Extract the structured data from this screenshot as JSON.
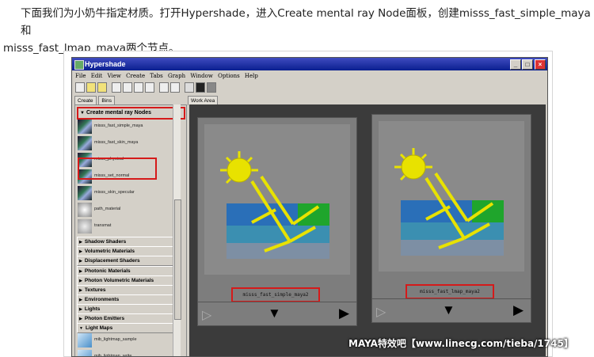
{
  "intro": {
    "line1": "下面我们为小奶牛指定材质。打开Hypershade，进入Create mental ray Node面板，创建misss_fast_simple_maya和",
    "line2": "misss_fast_lmap_maya两个节点。"
  },
  "window": {
    "title": "Hypershade",
    "controls": {
      "minimize": "_",
      "maximize": "□",
      "close": "×"
    }
  },
  "menu": [
    "File",
    "Edit",
    "View",
    "Create",
    "Tabs",
    "Graph",
    "Window",
    "Options",
    "Help"
  ],
  "left_tabs": [
    "Create",
    "Bins"
  ],
  "work_tab": "Work Area",
  "section": "Create mental ray Nodes",
  "nodes_list": [
    "misss_fast_simple_maya",
    "misss_fast_skin_maya",
    "misss_physical",
    "misss_set_normal",
    "misss_skin_specular",
    "path_material",
    "transmat"
  ],
  "categories": [
    "Shadow Shaders",
    "Volumetric Materials",
    "Displacement Shaders",
    "Photonic Materials",
    "Photon Volumetric Materials",
    "Textures",
    "Environments",
    "Lights",
    "Photon Emitters",
    "Light Maps"
  ],
  "lightmap_items": [
    "mib_lightmap_sample",
    "mib_lightmap_write"
  ],
  "work_nodes": [
    {
      "name": "misss_fast_simple_maya2"
    },
    {
      "name": "misss_fast_lmap_maya2"
    }
  ],
  "node_buttons": {
    "left": "▷",
    "mid": "▼",
    "right": "▶"
  },
  "watermark": "MAYA特效吧【www.linecg.com/tieba/1745】",
  "colors": {
    "highlight": "#d51a1a",
    "sun": "#e8e200",
    "water": "#2a6fb8",
    "grass": "#1fa52c"
  }
}
